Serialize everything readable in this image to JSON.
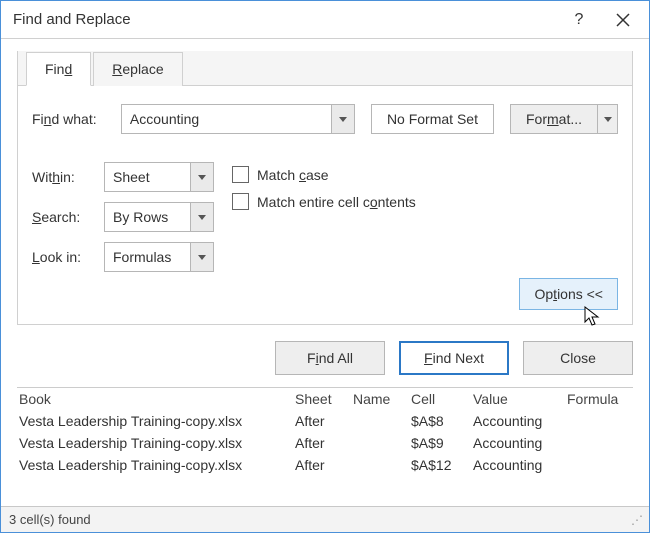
{
  "title": "Find and Replace",
  "tabs": {
    "find": "Find",
    "find_ul": "d",
    "replace": "Replace",
    "replace_ul": "R"
  },
  "findwhat": {
    "label_pre": "Fi",
    "label_ul": "n",
    "label_post": "d what:",
    "value": "Accounting"
  },
  "format_status": "No Format Set",
  "format_btn": {
    "label_pre": "For",
    "label_ul": "m",
    "label_post": "at..."
  },
  "within": {
    "label_pre": "Wit",
    "label_ul": "h",
    "label_post": "in:",
    "value": "Sheet"
  },
  "search": {
    "label_ul": "S",
    "label_post": "earch:",
    "value": "By Rows"
  },
  "lookin": {
    "label_ul": "L",
    "label_post": "ook in:",
    "value": "Formulas"
  },
  "matchcase": {
    "pre": "Match ",
    "ul": "c",
    "post": "ase"
  },
  "matchentire": {
    "pre": "Match entire cell c",
    "ul": "o",
    "post": "ntents"
  },
  "options_btn": {
    "pre": "Op",
    "ul": "t",
    "post": "ions <<"
  },
  "buttons": {
    "findall_pre": "F",
    "findall_ul": "i",
    "findall_post": "nd All",
    "findnext_ul": "F",
    "findnext_post": "ind Next",
    "close": "Close"
  },
  "results": {
    "headers": {
      "book": "Book",
      "sheet": "Sheet",
      "name": "Name",
      "cell": "Cell",
      "value": "Value",
      "formula": "Formula"
    },
    "rows": [
      {
        "book": "Vesta Leadership Training-copy.xlsx",
        "sheet": "After",
        "name": "",
        "cell": "$A$8",
        "value": "Accounting",
        "formula": ""
      },
      {
        "book": "Vesta Leadership Training-copy.xlsx",
        "sheet": "After",
        "name": "",
        "cell": "$A$9",
        "value": "Accounting",
        "formula": ""
      },
      {
        "book": "Vesta Leadership Training-copy.xlsx",
        "sheet": "After",
        "name": "",
        "cell": "$A$12",
        "value": "Accounting",
        "formula": ""
      }
    ]
  },
  "status": "3 cell(s) found"
}
